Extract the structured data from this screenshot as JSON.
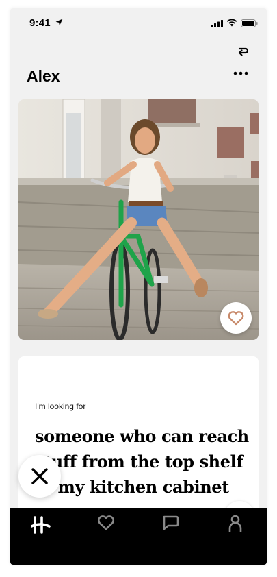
{
  "status_bar": {
    "time": "9:41"
  },
  "profile": {
    "name": "Alex"
  },
  "photo": {
    "description_icon": "cycling-photo",
    "like_icon": "heart-icon"
  },
  "prompt": {
    "label": "I'm looking for",
    "answer": "someone who can reach stuff from the top shelf of my kitchen cabinet"
  },
  "tabs": [
    {
      "icon": "hinge-logo-icon",
      "active": true
    },
    {
      "icon": "heart-icon",
      "active": false
    },
    {
      "icon": "chat-icon",
      "active": false
    },
    {
      "icon": "profile-icon",
      "active": false
    }
  ],
  "colors": {
    "accent": "#c88a6b",
    "tabbar": "#000000",
    "inactive_tab": "#8a8a8a"
  }
}
